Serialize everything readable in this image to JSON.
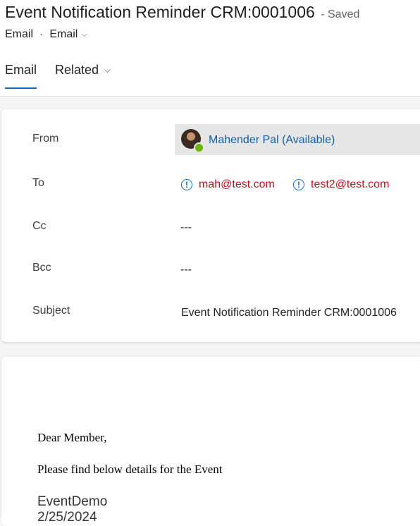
{
  "header": {
    "title": "Event Notification Reminder CRM:0001006",
    "save_status": "- Saved",
    "entity_type": "Email",
    "form_selector": "Email"
  },
  "tabs": [
    {
      "label": "Email",
      "active": true
    },
    {
      "label": "Related",
      "active": false
    }
  ],
  "fields": {
    "from_label": "From",
    "from_value": "Mahender Pal (Available)",
    "from_presence": "available",
    "to_label": "To",
    "to_recipients": [
      "mah@test.com",
      "test2@test.com"
    ],
    "cc_label": "Cc",
    "cc_value": "---",
    "bcc_label": "Bcc",
    "bcc_value": "---",
    "subject_label": "Subject",
    "subject_value": "Event Notification Reminder CRM:0001006"
  },
  "body": {
    "greeting": "Dear Member,",
    "intro": "Please find below details for the Event",
    "event_name": "EventDemo",
    "event_date": "2/25/2024"
  },
  "colors": {
    "accent": "#0f6cbd",
    "link": "#115ea3",
    "unresolved": "#c50f1f",
    "presence_available": "#6bb700"
  },
  "icons": {
    "warning": "!",
    "chevron": "⌵"
  }
}
